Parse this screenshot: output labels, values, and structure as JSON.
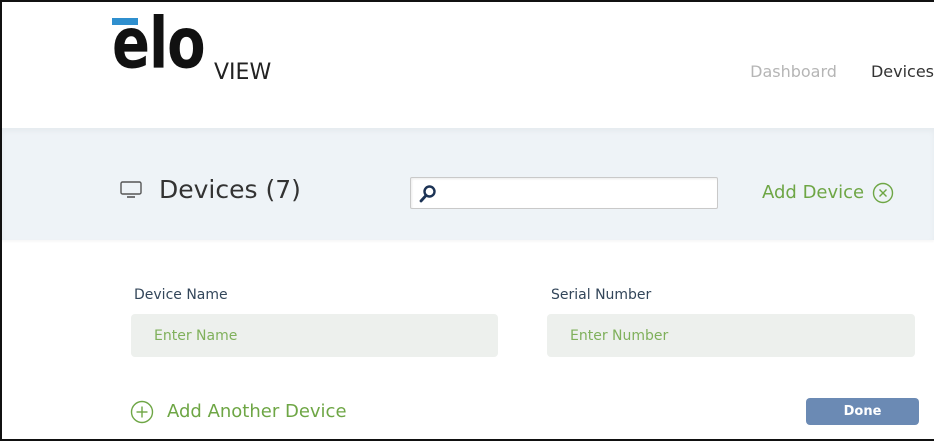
{
  "brand": {
    "logo_text": "elo",
    "logo_suffix": "VIEW",
    "accent_color": "#2f8fce"
  },
  "nav": {
    "items": [
      {
        "label": "Dashboard",
        "state": "inactive"
      },
      {
        "label": "Devices",
        "state": "active"
      }
    ]
  },
  "toolbar": {
    "icon": "monitor-icon",
    "title": "Devices (7)",
    "search": {
      "placeholder": "",
      "value": "",
      "icon": "search-icon"
    },
    "add_device_label": "Add Device",
    "add_device_icon": "close-circle-icon"
  },
  "form": {
    "device_name": {
      "label": "Device Name",
      "placeholder": "Enter Name",
      "value": ""
    },
    "serial_number": {
      "label": "Serial Number",
      "placeholder": "Enter Number",
      "value": ""
    },
    "add_another_label": "Add Another Device",
    "add_another_icon": "plus-circle-icon",
    "done_label": "Done"
  },
  "colors": {
    "green": "#6ea645",
    "band_bg": "#eef3f7",
    "input_bg": "#edf0ed",
    "done_bg": "#6b8ab4",
    "label_text": "#33465a"
  }
}
